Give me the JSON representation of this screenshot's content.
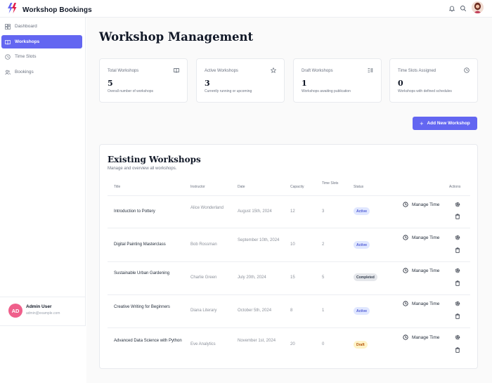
{
  "app": {
    "title": "Workshop Bookings",
    "logo_icon": "bolt-logo-icon",
    "accent_color": "#6366f1"
  },
  "topbar": {
    "icons": [
      "bell-icon",
      "search-icon",
      "user-avatar"
    ]
  },
  "sidebar": {
    "items": [
      {
        "label": "Dashboard",
        "icon": "dashboard-icon",
        "active": false
      },
      {
        "label": "Workshops",
        "icon": "book-icon",
        "active": true
      },
      {
        "label": "Time Slots",
        "icon": "clock-icon",
        "active": false
      },
      {
        "label": "Bookings",
        "icon": "users-icon",
        "active": false
      }
    ],
    "user": {
      "initials": "AD",
      "name": "Admin User",
      "email": "admin@example.com"
    }
  },
  "main": {
    "title": "Workshop Management",
    "stats": [
      {
        "label": "Total Workshops",
        "value": "5",
        "sub": "Overall number of workshops",
        "icon": "book-icon"
      },
      {
        "label": "Active Workshops",
        "value": "3",
        "sub": "Currently running or upcoming",
        "icon": "star-icon"
      },
      {
        "label": "Draft Workshops",
        "value": "1",
        "sub": "Workshops awaiting publication",
        "icon": "list-icon"
      },
      {
        "label": "Time Slots Assigned",
        "value": "0",
        "sub": "Workshops with defined schedules",
        "icon": "clock-icon"
      }
    ],
    "add_button": "Add New Workshop",
    "table": {
      "title": "Existing Workshops",
      "subtitle": "Manage and overview all workshops.",
      "columns": [
        "Title",
        "Instructor",
        "Date",
        "Capacity",
        "Time Slots",
        "Status",
        "Actions"
      ],
      "manage_label": "Manage Time",
      "rows": [
        {
          "title": "Introduction to Pottery",
          "instructor": "Alice Wonderland",
          "date": "August 15th, 2024",
          "capacity": "12",
          "slots": "3",
          "status": "Active",
          "status_color": "#4f5bd5"
        },
        {
          "title": "Digital Painting Masterclass",
          "instructor": "Bob Rossman",
          "date": "September 10th, 2024",
          "capacity": "10",
          "slots": "2",
          "status": "Active",
          "status_color": "#4f5bd5"
        },
        {
          "title": "Sustainable Urban Gardening",
          "instructor": "Charlie Green",
          "date": "July 20th, 2024",
          "capacity": "15",
          "slots": "5",
          "status": "Completed",
          "status_color": "#374151"
        },
        {
          "title": "Creative Writing for Beginners",
          "instructor": "Diana Literary",
          "date": "October 5th, 2024",
          "capacity": "8",
          "slots": "1",
          "status": "Active",
          "status_color": "#4f5bd5"
        },
        {
          "title": "Advanced Data Science with Python",
          "instructor": "Eve Analytics",
          "date": "November 1st, 2024",
          "capacity": "20",
          "slots": "0",
          "status": "Draft",
          "status_color": "#b45309"
        }
      ]
    }
  }
}
